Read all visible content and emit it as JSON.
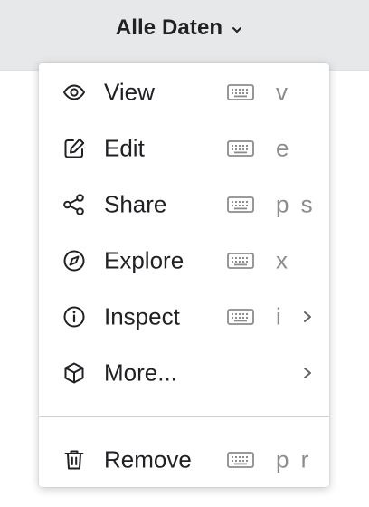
{
  "panel": {
    "title": "Alle Daten"
  },
  "menu": {
    "items": [
      {
        "label": "View",
        "icon": "eye-icon",
        "shortcut": "v",
        "keyboard_icon": true,
        "submenu": false
      },
      {
        "label": "Edit",
        "icon": "edit-icon",
        "shortcut": "e",
        "keyboard_icon": true,
        "submenu": false
      },
      {
        "label": "Share",
        "icon": "share-icon",
        "shortcut": "p s",
        "keyboard_icon": true,
        "submenu": false
      },
      {
        "label": "Explore",
        "icon": "compass-icon",
        "shortcut": "x",
        "keyboard_icon": true,
        "submenu": false
      },
      {
        "label": "Inspect",
        "icon": "info-icon",
        "shortcut": "i",
        "keyboard_icon": true,
        "submenu": true
      },
      {
        "label": "More...",
        "icon": "cube-icon",
        "shortcut": "",
        "keyboard_icon": false,
        "submenu": true
      }
    ],
    "footer_items": [
      {
        "label": "Remove",
        "icon": "trash-icon",
        "shortcut": "p r",
        "keyboard_icon": true,
        "submenu": false
      }
    ]
  },
  "colors": {
    "header_bg": "#e7e8ea",
    "text": "#202124",
    "shortcut_text": "#8a8c8e",
    "divider": "#cfd0d2"
  }
}
